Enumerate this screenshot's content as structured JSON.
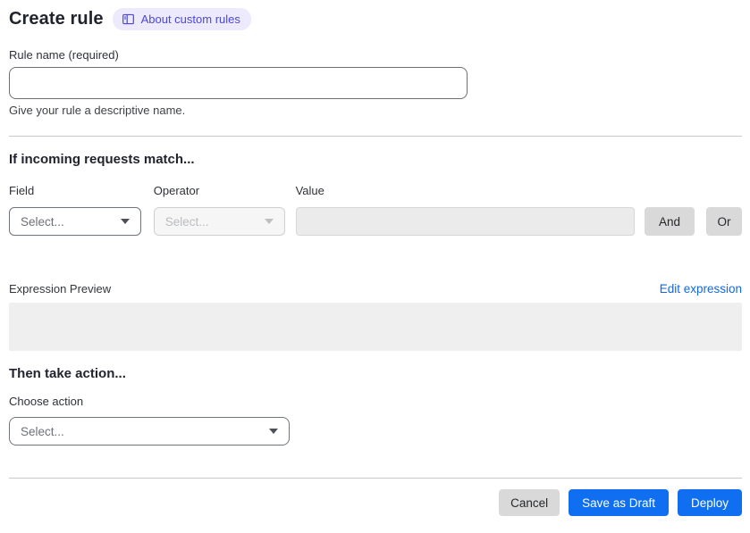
{
  "page": {
    "title": "Create rule",
    "badge_label": "About custom rules"
  },
  "rule_name": {
    "label": "Rule name (required)",
    "value": "",
    "helper": "Give your rule a descriptive name."
  },
  "match_section": {
    "heading": "If incoming requests match...",
    "field": {
      "label": "Field",
      "placeholder": "Select..."
    },
    "operator": {
      "label": "Operator",
      "placeholder": "Select..."
    },
    "value": {
      "label": "Value",
      "value": ""
    },
    "and_label": "And",
    "or_label": "Or",
    "expression_preview_label": "Expression Preview",
    "edit_expression_label": "Edit expression",
    "expression_value": ""
  },
  "action_section": {
    "heading": "Then take action...",
    "choose_action_label": "Choose action",
    "action_placeholder": "Select..."
  },
  "footer": {
    "cancel_label": "Cancel",
    "save_draft_label": "Save as Draft",
    "deploy_label": "Deploy"
  },
  "icons": {
    "badge": "book-icon",
    "selects": "chevron-down-icon"
  },
  "colors": {
    "primary_button_blue": "#0f6ff0",
    "link_blue": "#1467dd",
    "badge_background": "#eceafc",
    "badge_text": "#4b48d8",
    "neutral_button_gray": "#d9d9d9",
    "disabled_field_gray": "#ebebeb",
    "preview_box_gray": "#efefef"
  }
}
